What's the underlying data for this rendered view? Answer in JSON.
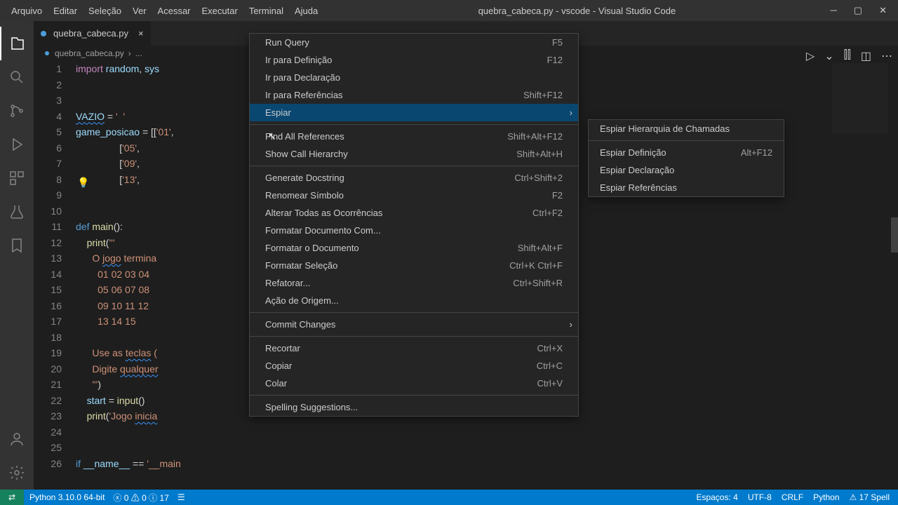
{
  "titlebar": {
    "menus": [
      "Arquivo",
      "Editar",
      "Seleção",
      "Ver",
      "Acessar",
      "Executar",
      "Terminal",
      "Ajuda"
    ],
    "title": "quebra_cabeca.py - vscode - Visual Studio Code"
  },
  "tab": {
    "name": "quebra_cabeca.py",
    "close": "×"
  },
  "breadcrumb": {
    "file": "quebra_cabeca.py",
    "more": "..."
  },
  "code": {
    "lines": [
      {
        "n": 1,
        "html": "<span class='kw'>import</span> <span class='var'>random</span>, <span class='var'>sys</span>"
      },
      {
        "n": 2,
        "html": ""
      },
      {
        "n": 3,
        "html": ""
      },
      {
        "n": 4,
        "html": "<span class='var squiggle'>VAZIO</span> <span class='op'>=</span> <span class='str'>'  '</span>"
      },
      {
        "n": 5,
        "html": "<span class='var'>game_posicao</span> <span class='op'>=</span> [[<span class='str'>'01'</span>,"
      },
      {
        "n": 6,
        "html": "                [<span class='str'>'05'</span>,"
      },
      {
        "n": 7,
        "html": "                [<span class='str'>'09'</span>,"
      },
      {
        "n": 8,
        "html": "                [<span class='str'>'13'</span>,"
      },
      {
        "n": 9,
        "html": ""
      },
      {
        "n": 10,
        "html": ""
      },
      {
        "n": 11,
        "html": "<span class='def'>def</span> <span class='fn'>main</span>():"
      },
      {
        "n": 12,
        "html": "    <span class='fn'>print</span>(<span class='str'>'''</span>"
      },
      {
        "n": 13,
        "html": "<span class='str'>      O <span class='squiggle'>jogo</span> termina</span>"
      },
      {
        "n": 14,
        "html": "<span class='str'>        01 02 03 04</span>"
      },
      {
        "n": 15,
        "html": "<span class='str'>        05 06 07 08</span>"
      },
      {
        "n": 16,
        "html": "<span class='str'>        09 10 11 12</span>"
      },
      {
        "n": 17,
        "html": "<span class='str'>        13 14 15</span>"
      },
      {
        "n": 18,
        "html": ""
      },
      {
        "n": 19,
        "html": "<span class='str'>      Use as <span class='squiggle'>teclas</span> (</span>                                               <span class='squiggle'>ero para</span> a <span class='squiggle'>posição correta</span></span>"
      },
      {
        "n": 20,
        "html": "<span class='str'>      Digite <span class='squiggle'>qualquer</span></span>"
      },
      {
        "n": 21,
        "html": "<span class='str'>      '''</span>)"
      },
      {
        "n": 22,
        "html": "    <span class='var'>start</span> <span class='op'>=</span> <span class='fn'>input</span>()"
      },
      {
        "n": 23,
        "html": "    <span class='fn'>print</span>(<span class='str'>'Jogo <span class='squiggle'>inicia</span></span>"
      },
      {
        "n": 24,
        "html": ""
      },
      {
        "n": 25,
        "html": ""
      },
      {
        "n": 26,
        "html": "<span class='def'>if</span> <span class='var'>__name__</span> <span class='op'>==</span> <span class='str'>'__main</span>"
      }
    ]
  },
  "ctx1": [
    {
      "t": "item",
      "label": "Run Query",
      "kbd": "F5"
    },
    {
      "t": "item",
      "label": "Ir para Definição",
      "kbd": "F12"
    },
    {
      "t": "item",
      "label": "Ir para Declaração",
      "kbd": ""
    },
    {
      "t": "item",
      "label": "Ir para Referências",
      "kbd": "Shift+F12"
    },
    {
      "t": "item",
      "label": "Espiar",
      "kbd": "",
      "sub": true,
      "hover": true
    },
    {
      "t": "sep"
    },
    {
      "t": "item",
      "label": "Find All References",
      "kbd": "Shift+Alt+F12"
    },
    {
      "t": "item",
      "label": "Show Call Hierarchy",
      "kbd": "Shift+Alt+H"
    },
    {
      "t": "sep"
    },
    {
      "t": "item",
      "label": "Generate Docstring",
      "kbd": "Ctrl+Shift+2"
    },
    {
      "t": "item",
      "label": "Renomear Símbolo",
      "kbd": "F2"
    },
    {
      "t": "item",
      "label": "Alterar Todas as Ocorrências",
      "kbd": "Ctrl+F2"
    },
    {
      "t": "item",
      "label": "Formatar Documento Com...",
      "kbd": ""
    },
    {
      "t": "item",
      "label": "Formatar o Documento",
      "kbd": "Shift+Alt+F"
    },
    {
      "t": "item",
      "label": "Formatar Seleção",
      "kbd": "Ctrl+K Ctrl+F"
    },
    {
      "t": "item",
      "label": "Refatorar...",
      "kbd": "Ctrl+Shift+R"
    },
    {
      "t": "item",
      "label": "Ação de Origem...",
      "kbd": ""
    },
    {
      "t": "sep"
    },
    {
      "t": "item",
      "label": "Commit Changes",
      "kbd": "",
      "sub": true
    },
    {
      "t": "sep"
    },
    {
      "t": "item",
      "label": "Recortar",
      "kbd": "Ctrl+X"
    },
    {
      "t": "item",
      "label": "Copiar",
      "kbd": "Ctrl+C"
    },
    {
      "t": "item",
      "label": "Colar",
      "kbd": "Ctrl+V"
    },
    {
      "t": "sep"
    },
    {
      "t": "item",
      "label": "Spelling Suggestions...",
      "kbd": ""
    }
  ],
  "ctx2": [
    {
      "t": "item",
      "label": "Espiar Hierarquia de Chamadas",
      "kbd": ""
    },
    {
      "t": "sep"
    },
    {
      "t": "item",
      "label": "Espiar Definição",
      "kbd": "Alt+F12"
    },
    {
      "t": "item",
      "label": "Espiar Declaração",
      "kbd": ""
    },
    {
      "t": "item",
      "label": "Espiar Referências",
      "kbd": ""
    }
  ],
  "status": {
    "python": "Python 3.10.0 64-bit",
    "errors": "0",
    "warnings": "0",
    "infos": "17",
    "spaces": "Espaços: 4",
    "encoding": "UTF-8",
    "eol": "CRLF",
    "lang": "Python",
    "spell": "17 Spell"
  }
}
